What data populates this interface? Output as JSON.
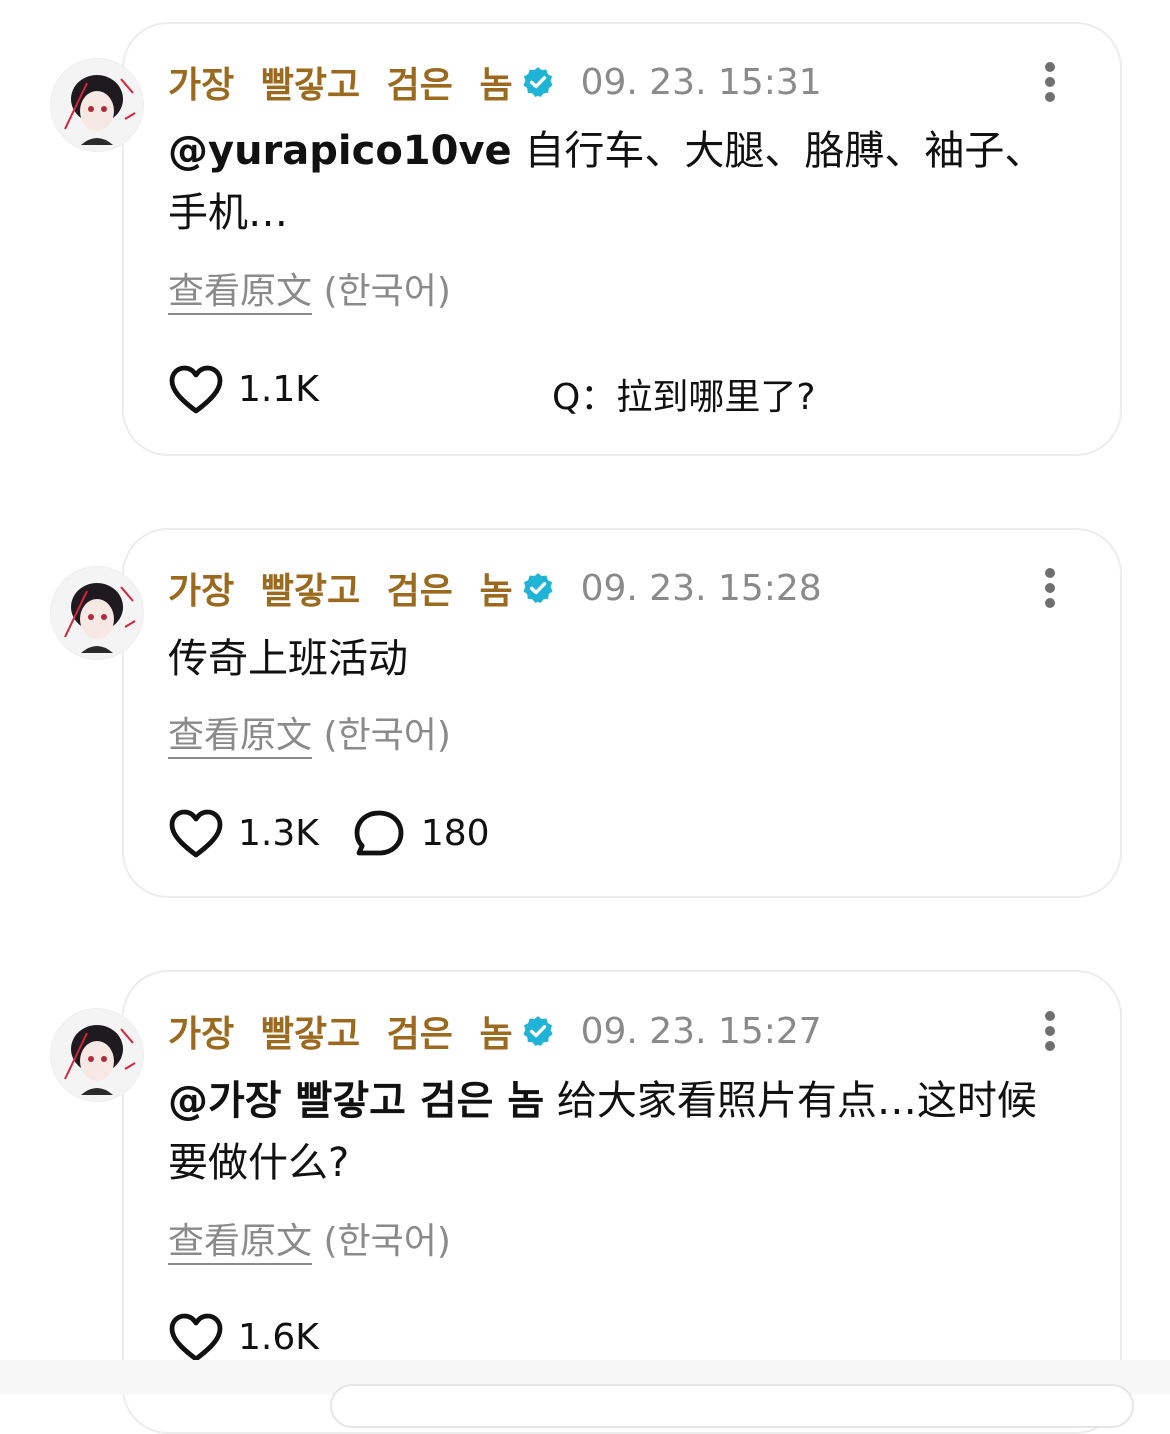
{
  "posts": [
    {
      "author": "가장 빨갛고 검은 놈",
      "time": "09. 23. 15:31",
      "mention": "@yurapico10ve",
      "text": " 自行车、大腿、胳膊、袖子、手机…",
      "translate_link": "查看原文",
      "translate_lang": " (한국어)",
      "likes": "1.1K",
      "replies": null,
      "note": "Q：拉到哪里了?"
    },
    {
      "author": "가장 빨갛고 검은 놈",
      "time": "09. 23. 15:28",
      "mention": "",
      "text": "传奇上班活动",
      "translate_link": "查看原文",
      "translate_lang": " (한국어)",
      "likes": "1.3K",
      "replies": "180",
      "note": null
    },
    {
      "author": "가장 빨갛고 검은 놈",
      "time": "09. 23. 15:27",
      "mention": "@가장 빨갛고 검은 놈",
      "text": " 给大家看照片有点…这时候要做什么?",
      "translate_link": "查看原文",
      "translate_lang": " (한국어)",
      "likes": "1.6K",
      "replies": null,
      "note": null
    }
  ],
  "colors": {
    "author": "#9b6a1f",
    "verified": "#1fb3d6",
    "muted": "#8a8a8a"
  },
  "icons": {
    "like": "heart-icon",
    "reply": "speech-bubble-icon",
    "more": "more-vertical-icon",
    "verified": "verified-badge-icon"
  }
}
